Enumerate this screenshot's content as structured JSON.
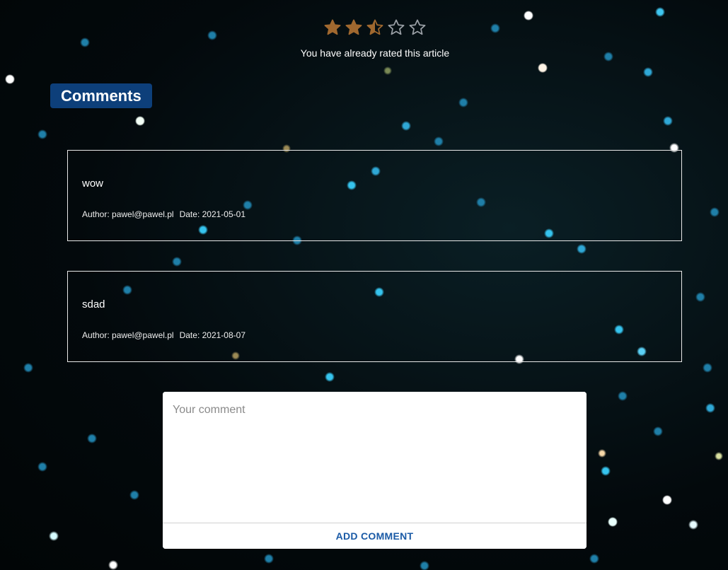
{
  "rating": {
    "value": 2.5,
    "max": 5,
    "filled_color": "#a0682f",
    "empty_color": "#9aa0a6",
    "message": "You have already rated this article",
    "star_icon": "star-icon"
  },
  "comments_section": {
    "title": "Comments",
    "title_bg_color": "#0d3f7a",
    "comments": [
      {
        "text": "wow",
        "author_label": "Author: pawel@pawel.pl",
        "date_label": "Date: 2021-05-01"
      },
      {
        "text": "sdad",
        "author_label": "Author: pawel@pawel.pl",
        "date_label": "Date: 2021-08-07"
      }
    ]
  },
  "comment_form": {
    "placeholder": "Your comment",
    "value": "",
    "submit_label": "ADD COMMENT",
    "submit_color": "#1a5aa6"
  }
}
